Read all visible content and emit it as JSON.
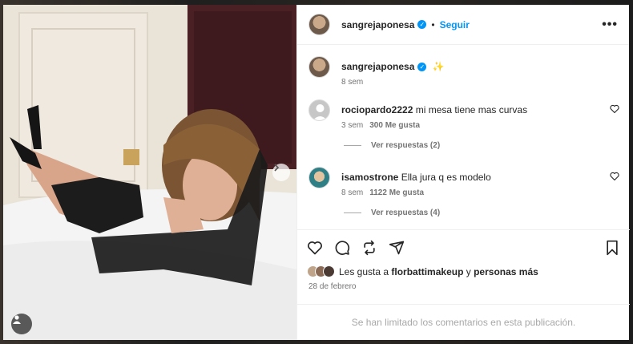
{
  "post": {
    "author": "sangrejaponesa",
    "follow_label": "Seguir",
    "more_label": "•••",
    "caption_emoji": "✨",
    "caption_time": "8 sem"
  },
  "comments": [
    {
      "user": "rociopardo2222",
      "text": "mi mesa tiene mas curvas",
      "time": "3 sem",
      "likes": "300 Me gusta",
      "replies": "Ver respuestas (2)"
    },
    {
      "user": "isamostrone",
      "text": "Ella jura q es modelo",
      "time": "8 sem",
      "likes": "1122 Me gusta",
      "replies": "Ver respuestas (4)"
    }
  ],
  "likes": {
    "prefix": "Les gusta a",
    "user": "florbattimakeup",
    "joiner": "y",
    "others": "personas más"
  },
  "date": "28 de febrero",
  "comments_limited": "Se han limitado los comentarios en esta publicación.",
  "colors": {
    "accent": "#0095f6",
    "muted": "#737373",
    "text": "#262626"
  },
  "icons": [
    "heart-icon",
    "comment-icon",
    "repost-icon",
    "share-icon",
    "bookmark-icon",
    "chevron-right-icon",
    "user-tag-icon"
  ]
}
